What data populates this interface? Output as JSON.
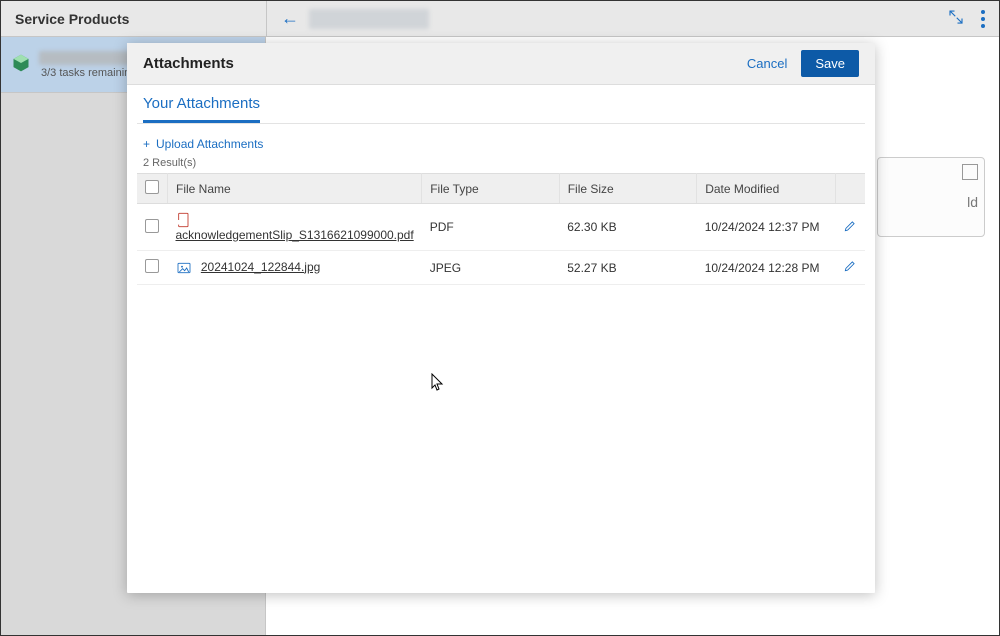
{
  "topbar": {
    "title": "Service Products"
  },
  "sidebar": {
    "item": {
      "tasks_remaining": "3/3 tasks remaining"
    }
  },
  "background_card": {
    "text": "ld"
  },
  "modal": {
    "title": "Attachments",
    "cancel_label": "Cancel",
    "save_label": "Save",
    "tab_label": "Your Attachments",
    "upload_label": "Upload Attachments",
    "result_count": "2 Result(s)",
    "columns": {
      "file_name": "File Name",
      "file_type": "File Type",
      "file_size": "File Size",
      "date_modified": "Date Modified"
    },
    "rows": [
      {
        "icon": "pdf",
        "file_name": "acknowledgementSlip_S1316621099000.pdf",
        "file_type": "PDF",
        "file_size": "62.30 KB",
        "date_modified": "10/24/2024 12:37 PM"
      },
      {
        "icon": "image",
        "file_name": "20241024_122844.jpg",
        "file_type": "JPEG",
        "file_size": "52.27 KB",
        "date_modified": "10/24/2024 12:28 PM"
      }
    ]
  }
}
